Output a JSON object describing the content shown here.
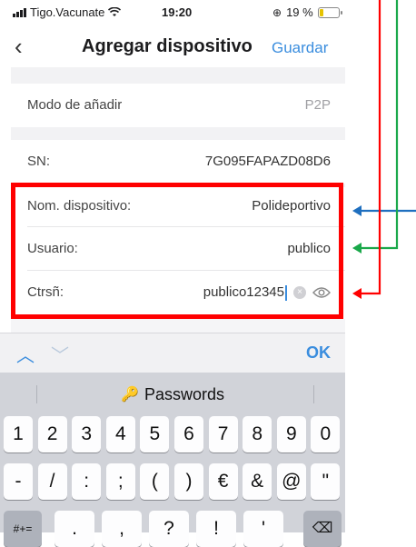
{
  "status_bar": {
    "carrier": "Tigo.Vacunate",
    "time": "19:20",
    "battery": "19 %",
    "battery_level": 0.19
  },
  "nav": {
    "back_icon": "chevron-left-icon",
    "title": "Agregar dispositivo",
    "save": "Guardar"
  },
  "form": {
    "mode": {
      "label": "Modo de añadir",
      "value": "P2P"
    },
    "sn": {
      "label": "SN:",
      "value": "7G095FAPAZD08D6"
    },
    "name": {
      "label": "Nom. dispositivo:",
      "value": "Polideportivo"
    },
    "user": {
      "label": "Usuario:",
      "value": "publico"
    },
    "password": {
      "label": "Ctrsñ:",
      "value": "publico12345"
    }
  },
  "keyboard": {
    "accessory_ok": "OK",
    "passwords_label": "Passwords",
    "row1": [
      "1",
      "2",
      "3",
      "4",
      "5",
      "6",
      "7",
      "8",
      "9",
      "0"
    ],
    "row2": [
      "-",
      "/",
      ":",
      ";",
      "(",
      ")",
      "€",
      "&",
      "@",
      "\""
    ],
    "row3": [
      ".",
      ",",
      "?",
      "!",
      "'"
    ],
    "mode_key": "#+="
  },
  "annotation_colors": {
    "box": "#ff0000",
    "blue": "#1f6fbf",
    "green": "#1aa84a",
    "red": "#ff0000"
  }
}
